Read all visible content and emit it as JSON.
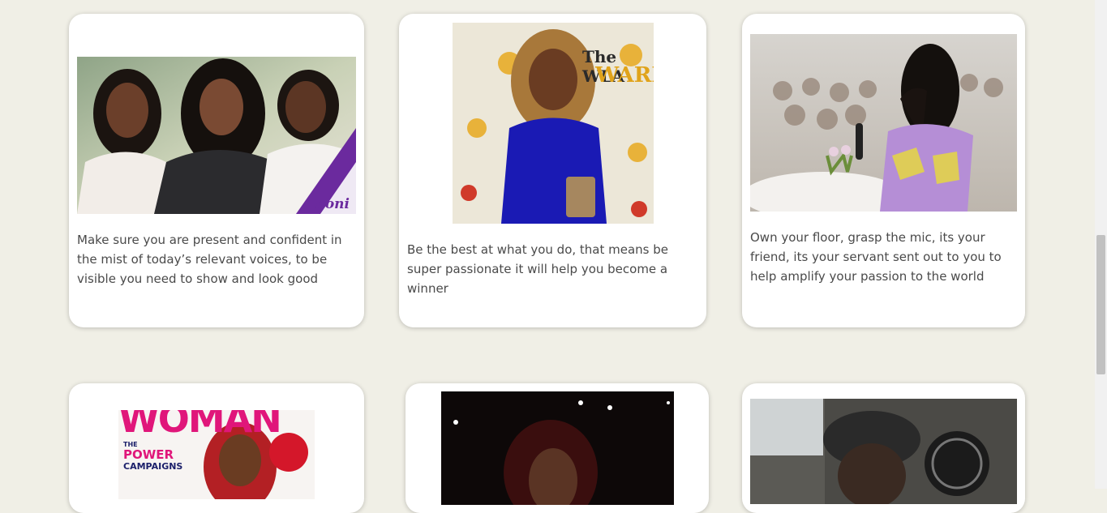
{
  "cards": [
    {
      "image": "women-panel-photo",
      "brand": "noni",
      "caption": "Make sure you are present and confident in the mist of today’s relevant voices, to be visible you need to show and look good"
    },
    {
      "image": "wla-awards-photo",
      "sign_line1": "The WLA",
      "sign_line2": "WARDS",
      "caption": "Be the best at what you do, that means be super passionate it will help you become a winner"
    },
    {
      "image": "speaker-with-mic-photo",
      "caption": "Own your floor, grasp the mic, its your friend, its your servant sent out to you to help amplify your passion to the world"
    },
    {
      "image": "woman-magazine-cover",
      "masthead": "WOMAN",
      "headline_1": "THE",
      "headline_2": "POWER",
      "headline_3": "CAMPAIGNS"
    },
    {
      "image": "stage-portrait-photo"
    },
    {
      "image": "studio-recording-photo"
    }
  ],
  "colors": {
    "background": "#f0efe6",
    "card": "#ffffff",
    "text": "#4a4a4a",
    "accent_purple": "#6b2a9e",
    "magenta": "#e0167a"
  }
}
